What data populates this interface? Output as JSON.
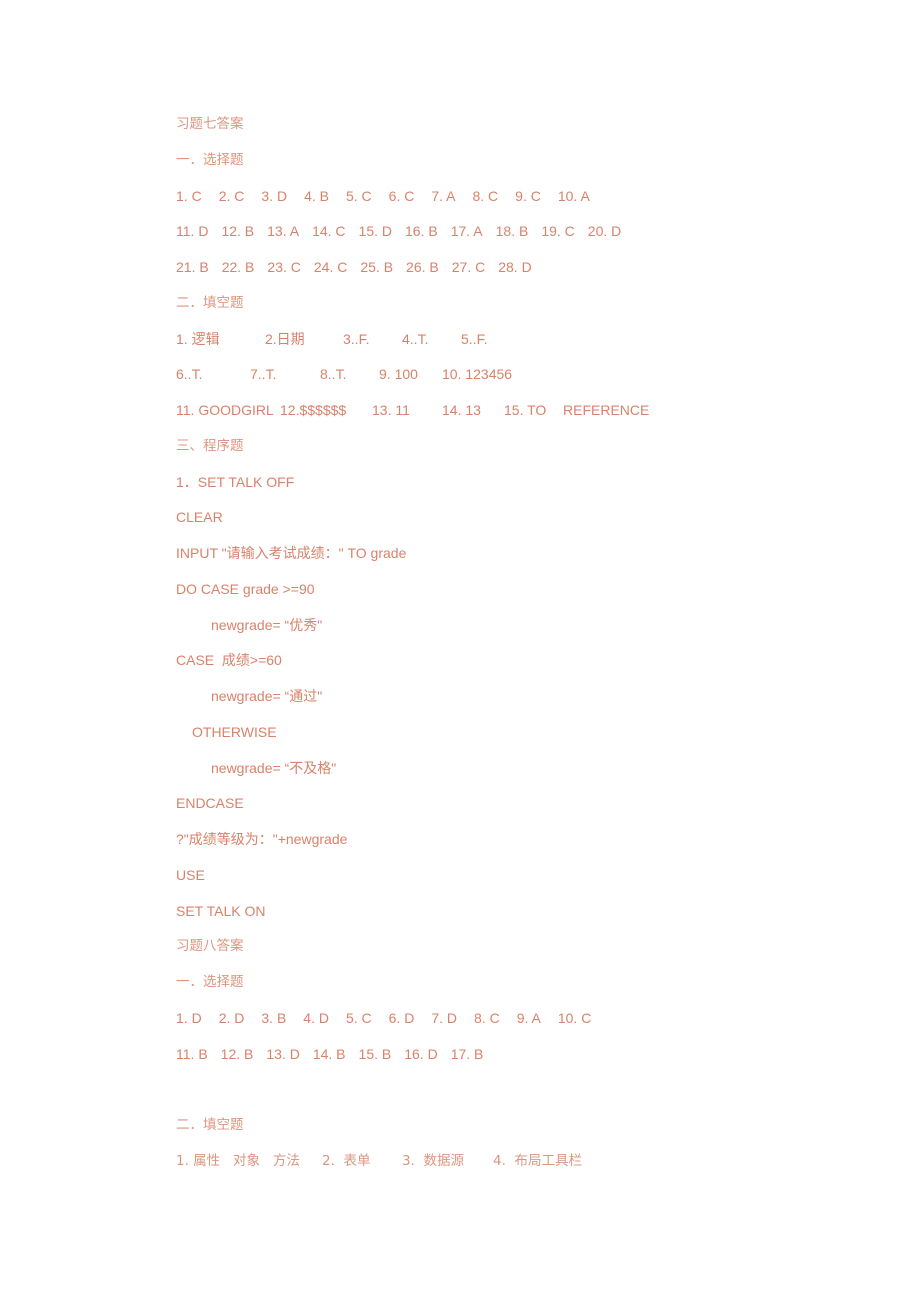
{
  "colors": {
    "text": "#d9826a",
    "heading": "#dc9680",
    "background": "#ffffff"
  },
  "ch7": {
    "title": "习题七答案",
    "mc_heading": "一．选择题",
    "mc_rows": [
      [
        "1. C",
        "2. C",
        "3. D",
        "4. B",
        "5. C",
        "6. C",
        "7. A",
        "8. C",
        "9. C",
        "10. A"
      ],
      [
        "11. D",
        "12. B",
        "13. A",
        "14. C",
        "15. D",
        "16. B",
        "17. A",
        "18. B",
        "19. C",
        "20. D"
      ],
      [
        "21. B",
        "22. B",
        "23. C",
        "24. C",
        "25. B",
        "26. B",
        "27. C",
        "28. D"
      ]
    ],
    "fill_heading": "二．填空题",
    "fill_rows": [
      [
        "1. 逻辑",
        "2.日期",
        "3..F.",
        "4..T.",
        "5..F."
      ],
      [
        "6..T.",
        "7..T.",
        "8..T.",
        "9. 100",
        "10. 123456"
      ],
      [
        "11. GOODGIRL",
        "12.$$$$$$",
        "13. 11",
        "14. 13",
        "15. TO",
        "REFERENCE"
      ]
    ],
    "prog_heading": "三、程序题",
    "program": [
      "1．SET TALK OFF",
      "CLEAR",
      "INPUT \"请输入考试成绩：\" TO grade",
      "DO CASE grade >=90",
      "newgrade= “优秀\"",
      "CASE  成绩>=60",
      "newgrade= “通过\"",
      "OTHERWISE",
      "newgrade= “不及格\"",
      "ENDCASE",
      "?\"成绩等级为：\"+newgrade",
      "USE",
      "SET TALK ON"
    ]
  },
  "ch8": {
    "title": "习题八答案",
    "mc_heading": "一．选择题",
    "mc_rows": [
      [
        "1. D",
        "2. D",
        "3. B",
        "4. D",
        "5. C",
        "6. D",
        "7. D",
        "8. C",
        "9. A",
        "10. C"
      ],
      [
        "11. B",
        "12. B",
        "13. D",
        "14. B",
        "15. B",
        "16. D",
        "17. B"
      ]
    ],
    "fill_heading": "二．填空题",
    "fill_rows": [
      [
        "1. 属性   对象   方法",
        "2.  表单",
        "3.  数据源",
        "4.  布局工具栏"
      ]
    ]
  }
}
